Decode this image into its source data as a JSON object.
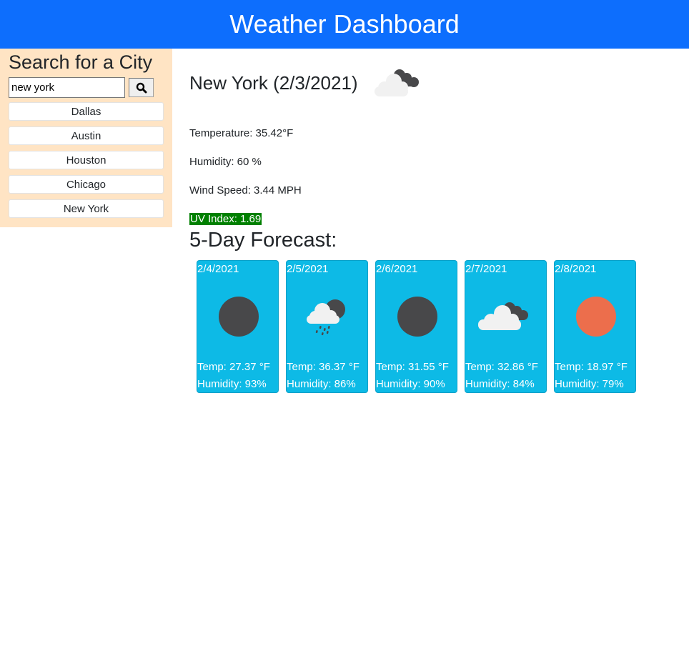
{
  "header": {
    "title": "Weather Dashboard"
  },
  "sidebar": {
    "heading": "Search for a City",
    "search": {
      "value": "new york",
      "placeholder": "",
      "button_icon": "search-icon"
    },
    "cities": [
      "Dallas",
      "Austin",
      "Houston",
      "Chicago",
      "New York"
    ]
  },
  "current": {
    "title": "New York (2/3/2021)",
    "icon": "broken-clouds-icon",
    "temperature": "Temperature: 35.42°F",
    "humidity": "Humidity: 60 %",
    "wind": "Wind Speed: 3.44 MPH",
    "uv": "UV Index: 1.69",
    "uv_color": "#008000"
  },
  "forecast": {
    "title": "5-Day Forecast:",
    "days": [
      {
        "date": "2/4/2021",
        "icon": "clear-night-icon",
        "temp": "Temp: 27.37 °F",
        "humidity": "Humidity: 93%"
      },
      {
        "date": "2/5/2021",
        "icon": "rain-night-icon",
        "temp": "Temp: 36.37 °F",
        "humidity": "Humidity: 86%"
      },
      {
        "date": "2/6/2021",
        "icon": "clear-night-icon",
        "temp": "Temp: 31.55 °F",
        "humidity": "Humidity: 90%"
      },
      {
        "date": "2/7/2021",
        "icon": "broken-clouds-icon",
        "temp": "Temp: 32.86 °F",
        "humidity": "Humidity: 84%"
      },
      {
        "date": "2/8/2021",
        "icon": "clear-sun-icon",
        "temp": "Temp: 18.97 °F",
        "humidity": "Humidity: 79%"
      }
    ]
  },
  "colors": {
    "header": "#0d6efd",
    "sidebar": "#ffe4c4",
    "card": "#0dbae6",
    "sun": "#ec6e4c",
    "moon": "#48484a",
    "cloud": "#f1f1f1"
  }
}
